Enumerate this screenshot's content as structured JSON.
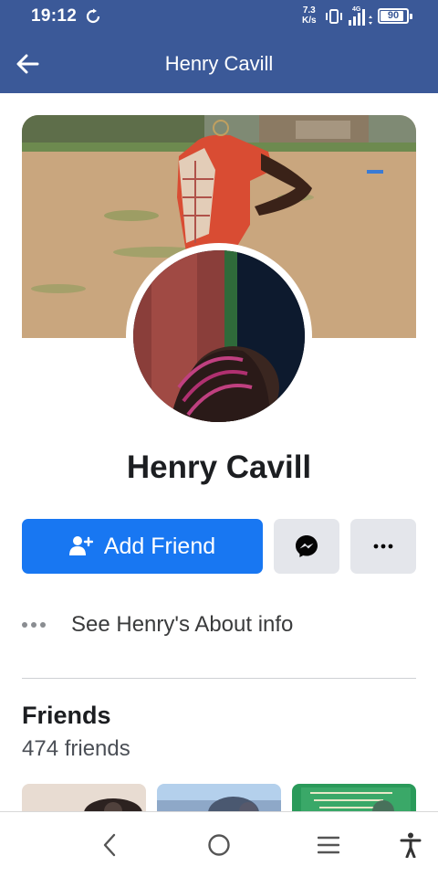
{
  "status_bar": {
    "time": "19:12",
    "net_speed_value": "7.3",
    "net_speed_unit": "K/s",
    "network_type": "4G",
    "battery_level": "90",
    "battery_fraction": 0.9
  },
  "header": {
    "title": "Henry Cavill"
  },
  "profile": {
    "name": "Henry Cavill"
  },
  "actions": {
    "add_friend_label": "Add Friend"
  },
  "about": {
    "label": "See Henry's About info"
  },
  "friends": {
    "title": "Friends",
    "count_text": "474 friends"
  },
  "nav": {
    "icons": [
      "back-icon",
      "home-icon",
      "recents-icon",
      "accessibility-icon"
    ]
  },
  "colors": {
    "header_bg": "#3b5998",
    "primary_button": "#1877f2",
    "secondary_button": "#e4e6eb"
  }
}
